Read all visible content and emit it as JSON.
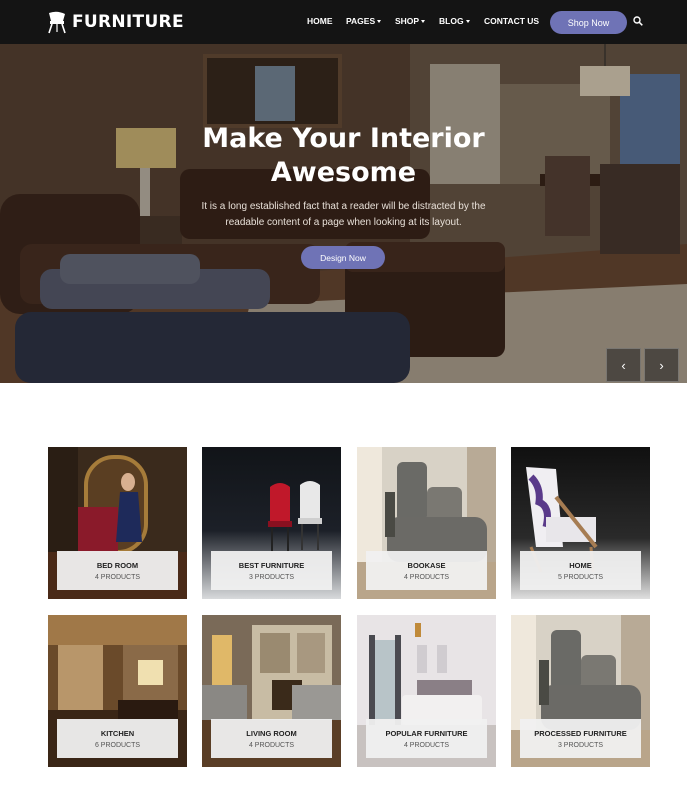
{
  "header": {
    "brand": "FURNITURE",
    "nav": [
      {
        "label": "HOME",
        "has_dropdown": false
      },
      {
        "label": "PAGES",
        "has_dropdown": true
      },
      {
        "label": "SHOP",
        "has_dropdown": true
      },
      {
        "label": "BLOG",
        "has_dropdown": true
      },
      {
        "label": "CONTACT US",
        "has_dropdown": false
      }
    ],
    "cta_label": "Shop Now",
    "search_icon": "search-icon"
  },
  "hero": {
    "title_line1": "Make Your Interior",
    "title_line2": "Awesome",
    "subtitle_line1": "It is a long established fact that a reader will be distracted by the",
    "subtitle_line2": "readable content of a page when looking at its layout.",
    "button_label": "Design Now",
    "prev_arrow": "‹",
    "next_arrow": "›"
  },
  "categories": [
    {
      "name": "BED ROOM",
      "count": "4 PRODUCTS"
    },
    {
      "name": "BEST FURNITURE",
      "count": "3 PRODUCTS"
    },
    {
      "name": "BOOKASE",
      "count": "4 PRODUCTS"
    },
    {
      "name": "HOME",
      "count": "5 PRODUCTS"
    },
    {
      "name": "KITCHEN",
      "count": "6 PRODUCTS"
    },
    {
      "name": "LIVING ROOM",
      "count": "4 PRODUCTS"
    },
    {
      "name": "POPULAR FURNITURE",
      "count": "4 PRODUCTS"
    },
    {
      "name": "PROCESSED FURNITURE",
      "count": "3 PRODUCTS"
    }
  ],
  "colors": {
    "accent": "#6f73b6",
    "header_bg": "#141414"
  }
}
